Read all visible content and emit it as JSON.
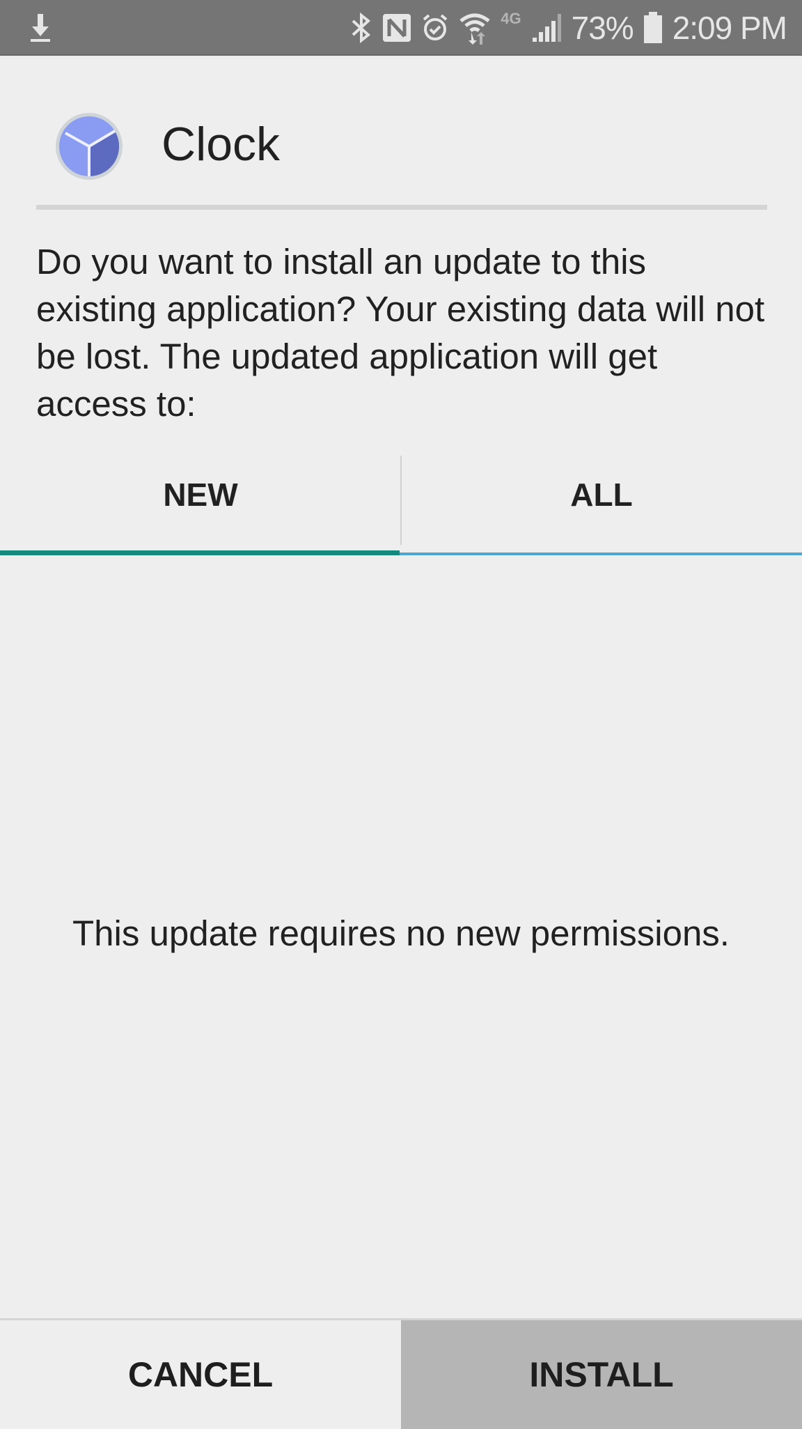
{
  "status_bar": {
    "left_icons": [
      "download-icon"
    ],
    "right_icons": [
      "bluetooth-icon",
      "nfc-icon",
      "alarm-icon",
      "wifi-icon",
      "4g-lte-icon",
      "signal-icon"
    ],
    "battery_percent": "73%",
    "battery_icon": "battery-icon",
    "time": "2:09 PM"
  },
  "header": {
    "app_icon": "clock-app-icon",
    "app_name": "Clock",
    "icon_colors": {
      "light": "#8a9cf2",
      "dark": "#5c6bc0",
      "rim": "#cfd4d8"
    }
  },
  "message": "Do you want to install an update to this existing application? Your existing data will not be lost. The updated application will get access to:",
  "tabs": [
    {
      "label": "NEW",
      "selected": true
    },
    {
      "label": "ALL",
      "selected": false
    }
  ],
  "tab_colors": {
    "selected_indicator": "#138a7b",
    "unselected_indicator": "#4fa7cf"
  },
  "content": {
    "empty_message": "This update requires no new permissions."
  },
  "buttons": {
    "cancel": "CANCEL",
    "install": "INSTALL"
  }
}
